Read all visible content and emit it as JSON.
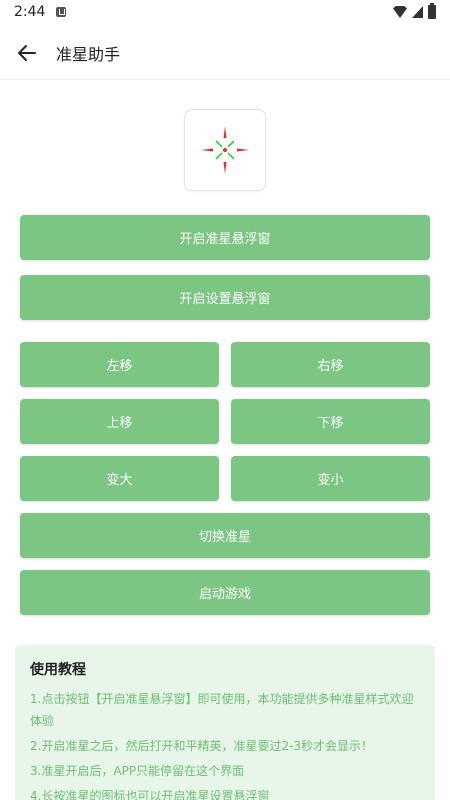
{
  "status_bar": {
    "time": "2:44",
    "notification_icon": "a-icon",
    "icons": [
      "wifi-icon",
      "cellular-icon",
      "battery-icon"
    ]
  },
  "app_bar": {
    "title": "准星助手",
    "back_icon": "arrow-left-icon"
  },
  "logo": {
    "icon": "crosshair-icon",
    "colors": {
      "red": "#e0312b",
      "green": "#33cc44"
    }
  },
  "buttons": {
    "open_crosshair_overlay": "开启准星悬浮窗",
    "open_settings_overlay": "开启设置悬浮窗",
    "move_left": "左移",
    "move_right": "右移",
    "move_up": "上移",
    "move_down": "下移",
    "enlarge": "变大",
    "shrink": "变小",
    "switch_crosshair": "切换准星",
    "launch_game": "启动游戏"
  },
  "tutorial": {
    "heading": "使用教程",
    "lines": [
      "1.点击按钮【开启准星悬浮窗】即可使用，本功能提供多种准星样式欢迎体验",
      "2.开启准星之后，然后打开和平精英，准星要过2-3秒才会显示！",
      "3.准星开启后，APP只能停留在这个界面",
      "4.长按准星的图标也可以开启准星设置悬浮窗"
    ]
  },
  "colors": {
    "accent": "#7cc683",
    "tutorial_bg": "#e8f6ea",
    "tutorial_text": "#6cbf75"
  }
}
